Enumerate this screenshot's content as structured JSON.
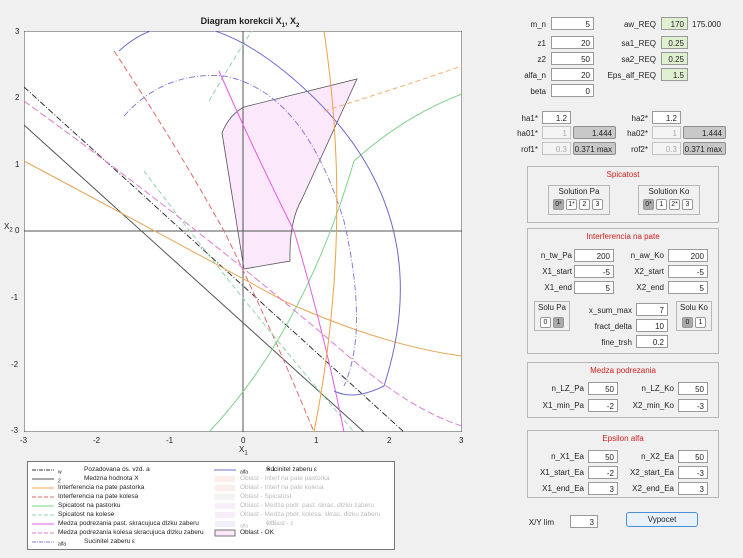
{
  "plot": {
    "title": "Diagram  korekcii  X",
    "title_sub1": "1",
    "title_mid": ", X",
    "title_sub2": "2",
    "xlabel": "X",
    "xlabel_sub": "1",
    "ylabel": "X",
    "ylabel_sub": "2",
    "xticks": [
      "-3",
      "-2",
      "-1",
      "0",
      "1",
      "2",
      "3"
    ],
    "yticks": [
      "3",
      "2",
      "1",
      "0",
      "-1",
      "-2",
      "-3"
    ]
  },
  "chart_data": {
    "type": "line",
    "title": "Diagram korekcii X1, X2",
    "xlabel": "X1",
    "ylabel": "X2",
    "xlim": [
      -3,
      3
    ],
    "ylim": [
      -3,
      3
    ],
    "grid": false,
    "series": [
      {
        "name": "Pozadovana os. vzd. aw",
        "x": [
          -3,
          2.2
        ],
        "y": [
          2.2,
          -3
        ]
      },
      {
        "name": "Medzna hodnota X2",
        "x": [
          -3,
          1.6
        ],
        "y": [
          1.6,
          -3
        ]
      },
      {
        "name": "Interferencia na pate pastorka",
        "x": [
          -3,
          -2,
          -1,
          0,
          1,
          2,
          3
        ],
        "y": [
          0.95,
          0.58,
          0.2,
          -0.3,
          -0.9,
          -1.45,
          -1.8
        ]
      },
      {
        "name": "Interferencia na pate kolesa",
        "x": [
          -1.7,
          -1.2,
          -0.5,
          0,
          0.5,
          0.9
        ],
        "y": [
          3,
          2.2,
          1,
          0.2,
          -1.2,
          -2
        ]
      },
      {
        "name": "Spicatost na pastorku",
        "x": [
          -0.45,
          0.5,
          1.5,
          3
        ],
        "y": [
          -3,
          -2.3,
          1.2,
          2.05
        ]
      },
      {
        "name": "Spicatost na kolese",
        "x": [
          -0.45,
          0,
          0.5,
          1.2
        ],
        "y": [
          2.0,
          1.0,
          0,
          -1.8
        ]
      },
      {
        "name": "Medza podrezania past. skracujuca dlzku zaberu",
        "x": [
          -0.4,
          0,
          0.5,
          0.9
        ],
        "y": [
          2.6,
          2.0,
          0.4,
          -2.0
        ]
      },
      {
        "name": "Medza podrezania kolesa skracujuca dlzku zaberu",
        "x": [
          -3,
          -1.5,
          0,
          1.5,
          3
        ],
        "y": [
          1.7,
          0.9,
          0.3,
          -0.8,
          -3
        ]
      },
      {
        "name": "Sucinitel zaberu eps alfa",
        "x": [
          -1.6,
          -1.2,
          -0.5,
          0.2,
          1.0,
          2.0
        ],
        "y": [
          1.8,
          2.2,
          2.4,
          1.2,
          -1.5,
          -2.3
        ]
      },
      {
        "name": "Sucinitel zaberu eps alfa = 1",
        "x": [
          -1.6,
          -1.0,
          0,
          1.2,
          2.0,
          2.2
        ],
        "y": [
          2.9,
          3.0,
          2.5,
          1.8,
          0,
          -1.5
        ]
      },
      {
        "name": "Oblast - OK",
        "x": [
          0,
          1.55,
          1.6,
          0.45,
          0,
          -0.25,
          -0.3
        ],
        "y": [
          1.85,
          2.3,
          0.5,
          -0.5,
          -0.6,
          1.05,
          1.5
        ]
      }
    ]
  },
  "legend": {
    "left": [
      "Pozadovana  os.  vzd.  a",
      "Medzna  hodnota  X",
      "Interferencia na pate pastorka",
      "Interferencia na pate kolesa",
      "Spicatost na pastorku",
      "Spicatost na kolese",
      "Medza podrezania past. skracujuca dlzku zaberu",
      "Medza podrezania kolesa  skracujuca dlzku zaberu",
      "Sucinitel  zaberu  ε"
    ],
    "left_subs": [
      "w",
      "2",
      "",
      "",
      "",
      "",
      "",
      "",
      "alfa"
    ],
    "right": [
      "Sucinitel  zaberu  ε",
      "Oblast - Interf na pate pastorka",
      "Oblast - Interf na pate kolesa",
      "Oblast - Spicatost",
      "Oblast - Medza podr. past. skrac. dlzku zaberu",
      "Oblast - Medza podr. kolesa. skrac. dlzku zaberu",
      "Oblast - ε",
      "Oblast - OK"
    ],
    "right_sub0": "alfa",
    "right_suffix0": "  = 1",
    "right_sub6": "alfa",
    "right_suffix6": "  = 1"
  },
  "params": {
    "m_n_label": "m_n",
    "m_n": "5",
    "z1_label": "z1",
    "z1": "20",
    "z2_label": "z2",
    "z2": "50",
    "alfa_n_label": "alfa_n",
    "alfa_n": "20",
    "beta_label": "beta",
    "beta": "0",
    "aw_req_label": "aw_REQ",
    "aw_req": "170",
    "aw_extra": "175.000",
    "sa1_label": "sa1_REQ",
    "sa1": "0.25",
    "sa2_label": "sa2_REQ",
    "sa2": "0.25",
    "eps_label": "Eps_alf_REQ",
    "eps": "1.5"
  },
  "coef": {
    "ha1_label": "ha1*",
    "ha1": "1.2",
    "ha01_label": "ha01*",
    "ha01": "1",
    "ha01_gray": "1.444",
    "rof1_label": "rof1*",
    "rof1": "0.3",
    "rof1_gray": "0.371 max",
    "ha2_label": "ha2*",
    "ha2": "1.2",
    "ha02_label": "ha02*",
    "ha02": "1",
    "ha02_gray": "1.444",
    "rof2_label": "rof2*",
    "rof2": "0.3",
    "rof2_gray": "0.371 max"
  },
  "spicatost": {
    "title": "Spicatost",
    "pa_title": "Solution Pa",
    "pa_opts": [
      "0*",
      "1*",
      "2",
      "3"
    ],
    "ko_title": "Solution Ko",
    "ko_opts": [
      "0*",
      "1",
      "2*",
      "3"
    ]
  },
  "interf": {
    "title": "Interferencia na pate",
    "n_tw_pa_label": "n_tw_Pa",
    "n_tw_pa": "200",
    "x1_start_label": "X1_start",
    "x1_start": "-5",
    "x1_end_label": "X1_end",
    "x1_end": "5",
    "n_aw_ko_label": "n_aw_Ko",
    "n_aw_ko": "200",
    "x2_start_label": "X2_start",
    "x2_start": "-5",
    "x2_end_label": "X2_end",
    "x2_end": "5",
    "solu_pa": "Solu Pa",
    "solu_ko": "Solu Ko",
    "solu_pa_opts": [
      "0",
      "1"
    ],
    "solu_ko_opts": [
      "0",
      "1"
    ],
    "x_sum_max_label": "x_sum_max",
    "x_sum_max": "7",
    "fract_delta_label": "fract_delta",
    "fract_delta": "10",
    "fine_trsh_label": "fine_trsh",
    "fine_trsh": "0.2"
  },
  "medza": {
    "title": "Medza podrezania",
    "n_lz_pa_label": "n_LZ_Pa",
    "n_lz_pa": "50",
    "x1_min_pa_label": "X1_min_Pa",
    "x1_min_pa": "-2",
    "n_lz_ko_label": "n_LZ_Ko",
    "n_lz_ko": "50",
    "x2_min_ko_label": "X2_min_Ko",
    "x2_min_ko": "-3"
  },
  "eps": {
    "title": "Epsilon alfa",
    "n_x1_ea_label": "n_X1_Ea",
    "n_x1_ea": "50",
    "x1_start_ea_label": "X1_start_Ea",
    "x1_start_ea": "-2",
    "x1_end_ea_label": "X1_end_Ea",
    "x1_end_ea": "3",
    "n_x2_ea_label": "n_X2_Ea",
    "n_x2_ea": "50",
    "x2_start_ea_label": "X2_start_Ea",
    "x2_start_ea": "-3",
    "x2_end_ea_label": "X2_end_Ea",
    "x2_end_ea": "3"
  },
  "bottom": {
    "xy_lim_label": "X/Y lim",
    "xy_lim": "3",
    "vypocet": "Vypocet"
  }
}
